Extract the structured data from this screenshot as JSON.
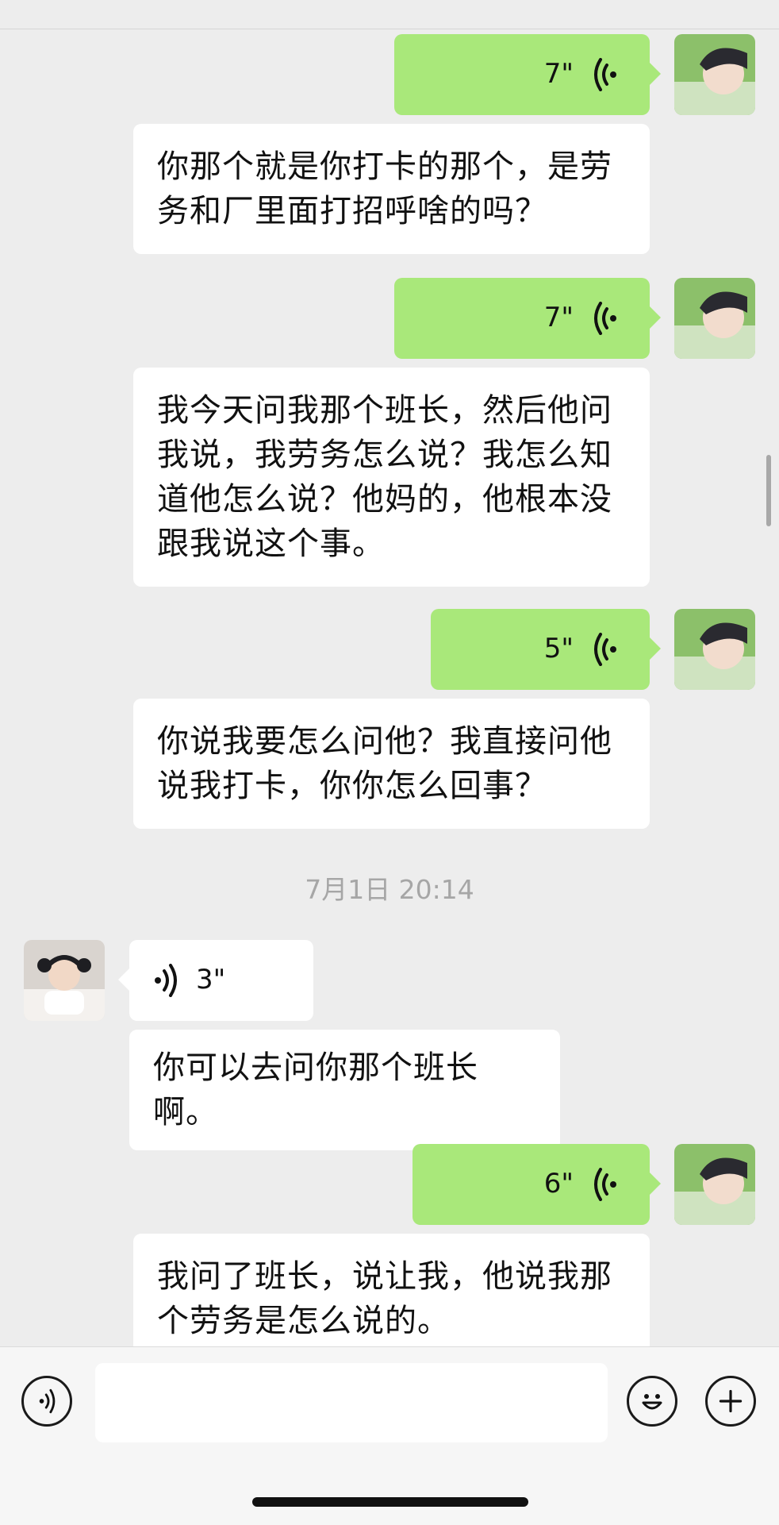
{
  "messages": [
    {
      "side": "out",
      "type": "voice",
      "duration": "7\"",
      "transcript": "你那个就是你打卡的那个，是劳务和厂里面打招呼啥的吗？"
    },
    {
      "side": "out",
      "type": "voice",
      "duration": "7\"",
      "transcript": "我今天问我那个班长，然后他问我说，我劳务怎么说？我怎么知道他怎么说？他妈的，他根本没跟我说这个事。"
    },
    {
      "side": "out",
      "type": "voice",
      "duration": "5\"",
      "transcript": "你说我要怎么问他？我直接问他说我打卡，你你怎么回事？"
    },
    {
      "side": "in",
      "type": "voice",
      "duration": "3\"",
      "transcript": "你可以去问你那个班长啊。"
    },
    {
      "side": "out",
      "type": "voice",
      "duration": "6\"",
      "transcript": "我问了班长，说让我，他说我那个劳务是怎么说的。"
    }
  ],
  "timestamp": "7月1日 20:14",
  "colors": {
    "outgoing_bubble": "#a9e87a",
    "incoming_bubble": "#ffffff",
    "background": "#ededed"
  },
  "input_bar": {
    "voice_button_icon": "voice-mode-icon",
    "emoji_button_icon": "emoji-icon",
    "more_button_icon": "plus-icon",
    "text_value": ""
  }
}
